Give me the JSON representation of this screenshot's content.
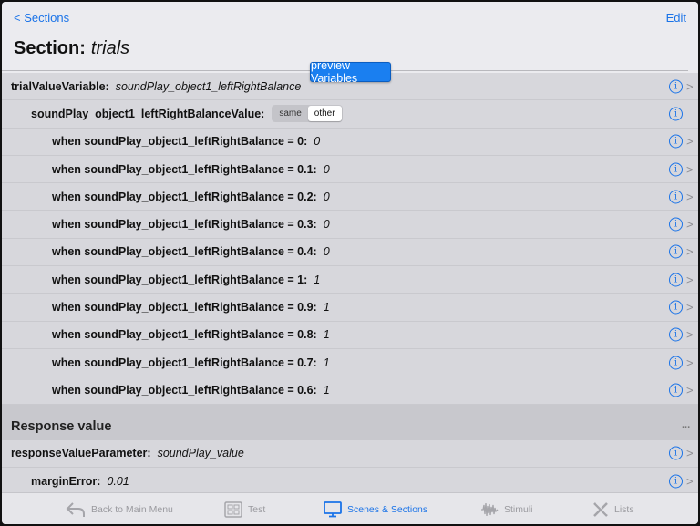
{
  "nav": {
    "back_label": "< Sections",
    "edit_label": "Edit",
    "title_prefix": "Section:",
    "title_name": "trials",
    "preview_label": "preview Variables"
  },
  "rows": [
    {
      "label": "trialValueVariable:",
      "value": "soundPlay_object1_leftRightBalance",
      "level": 0
    },
    {
      "label": "soundPlay_object1_leftRightBalanceValue:",
      "level": 1,
      "segmented": {
        "options": [
          "same",
          "other"
        ],
        "selected": "other"
      }
    },
    {
      "label": "when soundPlay_object1_leftRightBalance = 0:",
      "value": "0",
      "level": 2
    },
    {
      "label": "when soundPlay_object1_leftRightBalance = 0.1:",
      "value": "0",
      "level": 2
    },
    {
      "label": "when soundPlay_object1_leftRightBalance = 0.2:",
      "value": "0",
      "level": 2
    },
    {
      "label": "when soundPlay_object1_leftRightBalance = 0.3:",
      "value": "0",
      "level": 2
    },
    {
      "label": "when soundPlay_object1_leftRightBalance = 0.4:",
      "value": "0",
      "level": 2
    },
    {
      "label": "when soundPlay_object1_leftRightBalance = 1:",
      "value": "1",
      "level": 2
    },
    {
      "label": "when soundPlay_object1_leftRightBalance = 0.9:",
      "value": "1",
      "level": 2
    },
    {
      "label": "when soundPlay_object1_leftRightBalance = 0.8:",
      "value": "1",
      "level": 2
    },
    {
      "label": "when soundPlay_object1_leftRightBalance = 0.7:",
      "value": "1",
      "level": 2
    },
    {
      "label": "when soundPlay_object1_leftRightBalance = 0.6:",
      "value": "1",
      "level": 2
    }
  ],
  "response_section": {
    "title": "Response value",
    "more": "...",
    "rows": [
      {
        "label": "responseValueParameter:",
        "value": "soundPlay_value"
      },
      {
        "label": "marginError:",
        "value": "0.01"
      }
    ]
  },
  "tabs": {
    "back": "Back to Main Menu",
    "test": "Test",
    "scenes": "Scenes & Sections",
    "stimuli": "Stimuli",
    "lists": "Lists"
  },
  "icons": {
    "info": "info-icon",
    "chevron": "chevron-right-icon"
  },
  "colors": {
    "accent": "#1a73e8",
    "row_bg": "#d7d7dc",
    "preview_button": "#1a7ff0"
  }
}
